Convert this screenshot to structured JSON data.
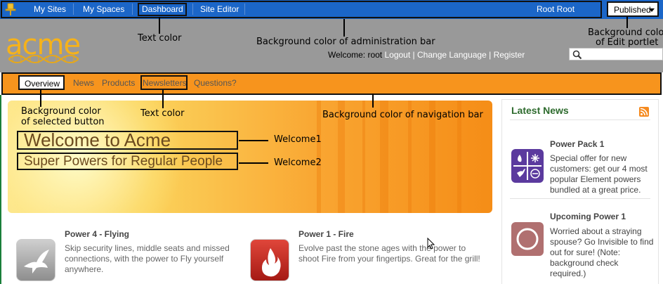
{
  "admin_bar": {
    "items": [
      "My Sites",
      "My Spaces",
      "Dashboard",
      "Site Editor"
    ],
    "user": "Root Root",
    "publish_state": "Published"
  },
  "header": {
    "logo_text": "acme",
    "welcome_label": "Welcome: root",
    "links": [
      "Logout",
      "Change Language",
      "Register"
    ],
    "search_placeholder": ""
  },
  "nav": {
    "items": [
      "Overview",
      "News",
      "Products",
      "Newsletters",
      "Questions?"
    ],
    "selected": "Overview"
  },
  "hero": {
    "title": "Welcome to Acme",
    "subtitle": "Super Powers for Regular People"
  },
  "features": [
    {
      "title": "Power 4 - Flying",
      "text": "Skip security lines, middle seats and missed connections, with the power to Fly yourself anywhere.",
      "icon": "dove-icon"
    },
    {
      "title": "Power 1 - Fire",
      "text": "Evolve past the stone ages with the power to shoot Fire from your fingertips. Great for the grill!",
      "icon": "flame-icon"
    }
  ],
  "sidebar": {
    "heading": "Latest News",
    "items": [
      {
        "title": "Power Pack 1",
        "text": "Special offer for new customers: get our 4 most popular Element powers bundled at a great price.",
        "icon": "power-pack-icon"
      },
      {
        "title": "Upcoming Power 1",
        "text": "Worried about a straying spouse? Go Invisible to find out for sure! (Note: background check required.)",
        "icon": "invisible-icon"
      }
    ]
  },
  "annotations": {
    "text_color_admin": "Text color",
    "admin_bg": "Background color of administration bar",
    "edit_portlet_bg_line1": "Background color",
    "edit_portlet_bg_line2": "of Edit portlet",
    "selected_button_bg_line1": "Background color",
    "selected_button_bg_line2": "of selected button",
    "text_color_nav": "Text color",
    "nav_bg": "Background color of navigation bar",
    "welcome1": "Welcome1",
    "welcome2": "Welcome2"
  },
  "colors": {
    "admin_bar": "#1b66c8",
    "header_band": "#999999",
    "nav_bar": "#f7941d",
    "news_heading": "#2e6b2e"
  }
}
